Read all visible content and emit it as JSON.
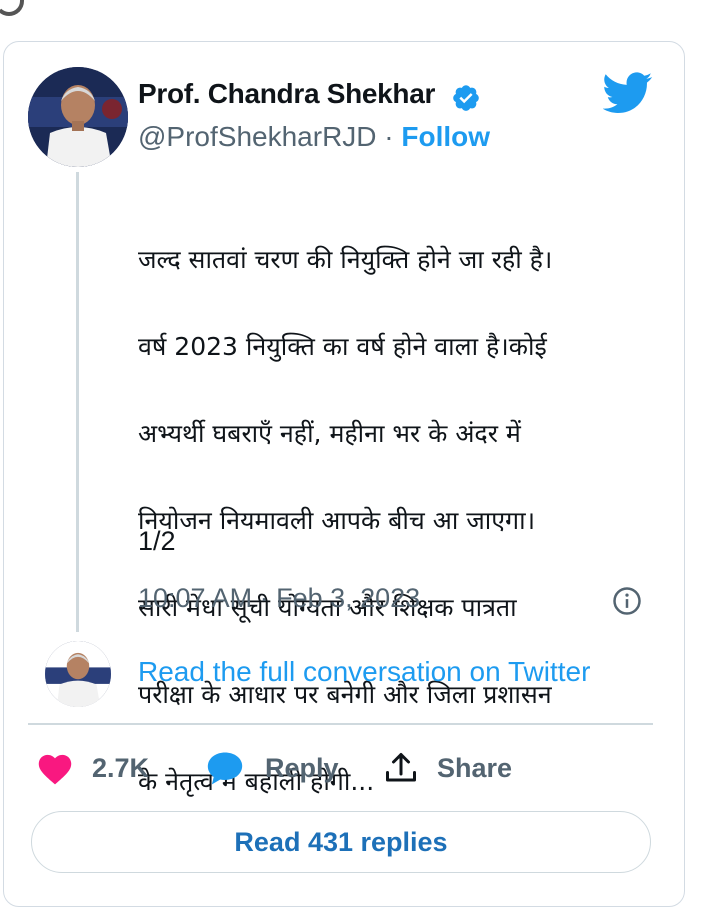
{
  "tweet": {
    "author_name": "Prof. Chandra Shekhar",
    "handle": "@ProfShekharRJD",
    "separator": "·",
    "follow_label": "Follow",
    "text_lines": [
      "जल्द सातवां चरण की नियुक्ति होने जा रही है।",
      "वर्ष 2023 नियुक्ति का वर्ष होने वाला है।कोई",
      "अभ्यर्थी घबराएँ नहीं, महीना भर के अंदर में",
      "नियोजन नियमावली आपके बीच आ जाएगा।",
      "सारी मेधा सूची योग्यता और शिक्षक पात्रता",
      "परीक्षा के आधार पर बनेगी और जिला प्रशासन",
      "के नेतृत्व में बहाली होगी..."
    ],
    "thread_counter": "1/2",
    "timestamp": "10:07 AM · Feb 3, 2023",
    "read_full_conversation": "Read the full conversation on Twitter"
  },
  "actions": {
    "like_count": "2.7K",
    "reply_label": "Reply",
    "share_label": "Share"
  },
  "read_replies_label": "Read 431 replies",
  "icons": {
    "verified": "verified-badge-icon",
    "twitter": "twitter-bird-icon",
    "info": "info-icon",
    "like": "heart-icon",
    "reply": "speech-bubble-icon",
    "share": "share-upload-icon"
  },
  "colors": {
    "accent_blue": "#1d9bf0",
    "like_pink": "#f91880",
    "secondary_text": "#536471",
    "replies_text": "#1d70b8"
  }
}
